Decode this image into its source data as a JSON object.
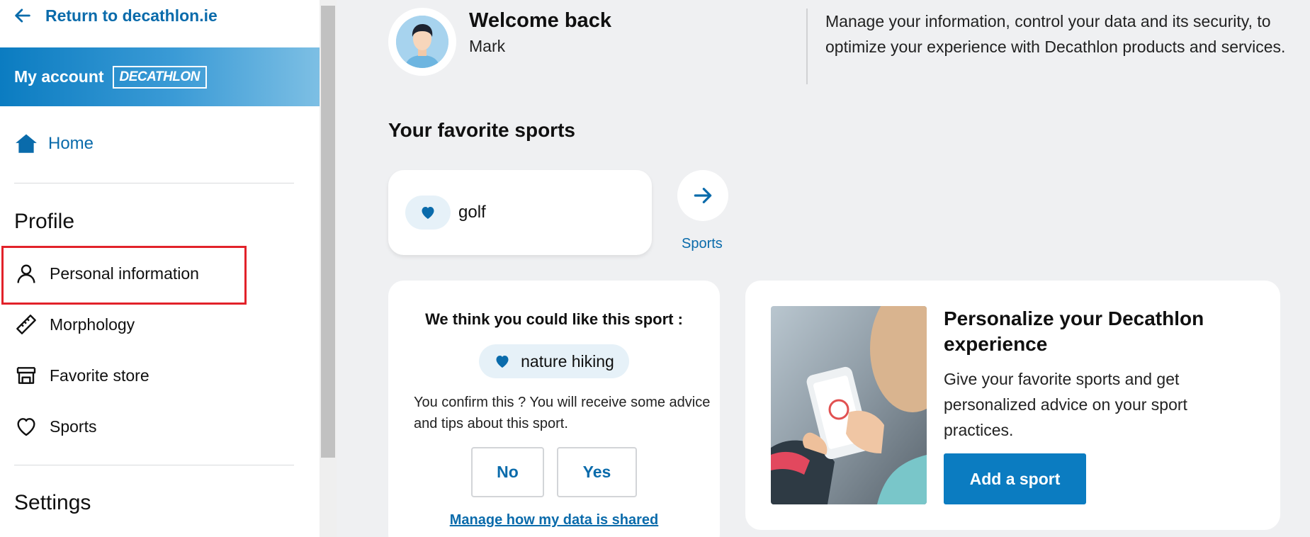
{
  "sidebar": {
    "return_label": "Return to decathlon.ie",
    "account_title": "My account",
    "brand_logo": "DECATHLON",
    "home_label": "Home",
    "profile_heading": "Profile",
    "items": [
      {
        "label": "Personal information",
        "icon": "person-icon"
      },
      {
        "label": "Morphology",
        "icon": "ruler-icon"
      },
      {
        "label": "Favorite store",
        "icon": "store-icon"
      },
      {
        "label": "Sports",
        "icon": "heart-icon"
      }
    ],
    "settings_heading": "Settings"
  },
  "header": {
    "welcome": "Welcome back",
    "user_name": "Mark",
    "description": "Manage your information, control your data and its security, to optimize your experience with Decathlon products and services."
  },
  "favorites": {
    "title": "Your favorite sports",
    "sport": "golf",
    "sports_link": "Sports"
  },
  "suggestion": {
    "title": "We think you could like this sport :",
    "sport": "nature hiking",
    "text": "You confirm this ? You will receive some advice and tips about this sport.",
    "no_label": "No",
    "yes_label": "Yes",
    "manage_link": "Manage how my data is shared"
  },
  "promo": {
    "title": "Personalize your Decathlon experience",
    "text": "Give your favorite sports and get personalized advice on your sport practices.",
    "button": "Add a sport"
  },
  "colors": {
    "accent": "#0a6bab",
    "primary_button": "#0b7cc1",
    "highlight": "#e2222a",
    "background": "#eff0f2"
  }
}
